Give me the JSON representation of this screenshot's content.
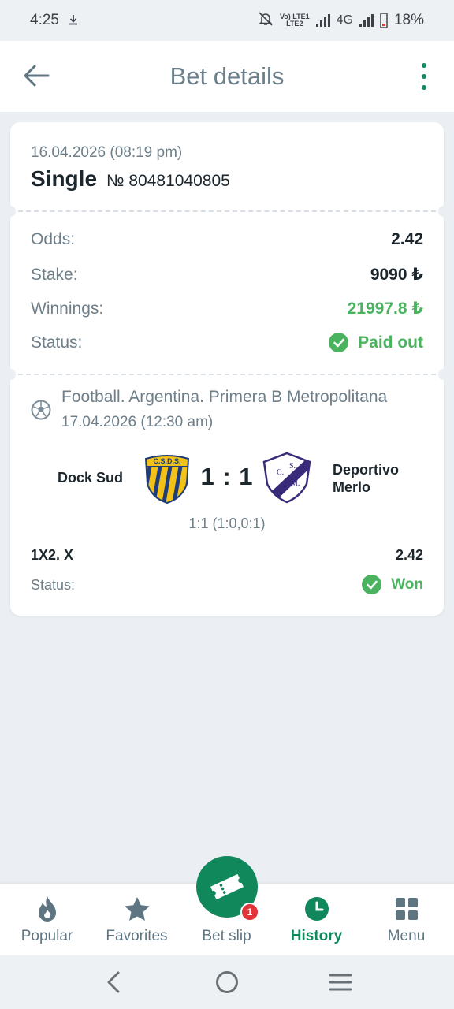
{
  "status_bar": {
    "time": "4:25",
    "network": "4G",
    "volte": "Vo) LTE1\nLTE2",
    "battery": "18%"
  },
  "header": {
    "title": "Bet details"
  },
  "bet": {
    "date": "16.04.2026 (08:19 pm)",
    "type": "Single",
    "number": "№ 80481040805",
    "odds_label": "Odds:",
    "odds": "2.42",
    "stake_label": "Stake:",
    "stake": "9090 ₺",
    "winnings_label": "Winnings:",
    "winnings": "21997.8 ₺",
    "status_label": "Status:",
    "status": "Paid out"
  },
  "event": {
    "league": "Football. Argentina. Primera B Metropolitana",
    "date": "17.04.2026 (12:30 am)",
    "team1": "Dock Sud",
    "team2_line1": "Deportivo",
    "team2_line2": "Merlo",
    "score": "1 : 1",
    "score_detail": "1:1 (1:0,0:1)",
    "crest1_text": "C.S.D.S.",
    "crest2_text1": "C.",
    "crest2_text2": "S.",
    "crest2_text3": "D.",
    "crest2_text4": "M.",
    "market": "1X2. X",
    "market_odds": "2.42",
    "status_label": "Status:",
    "status": "Won"
  },
  "bottom_nav": {
    "items": [
      {
        "label": "Popular",
        "icon": "fire-icon"
      },
      {
        "label": "Favorites",
        "icon": "star-icon"
      },
      {
        "label": "Bet slip",
        "icon": "ticket-icon"
      },
      {
        "label": "History",
        "icon": "clock-icon"
      },
      {
        "label": "Menu",
        "icon": "grid-icon"
      }
    ],
    "betslip_badge": "1",
    "active": "History"
  },
  "colors": {
    "accent": "#11875c",
    "success": "#4bb35f",
    "badge": "#e2353a",
    "muted": "#6e7f89"
  }
}
